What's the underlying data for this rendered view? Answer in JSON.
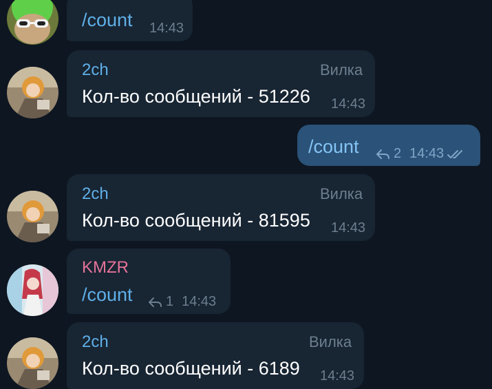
{
  "colors": {
    "background": "#0e1621",
    "bubble_in": "#182533",
    "bubble_out": "#2b5278",
    "sender_2ch": "#5fb0e8",
    "sender_kmzr": "#e57399",
    "command": "#5fb0e8",
    "muted": "#6d7f8f"
  },
  "messages": [
    {
      "text": "/count",
      "time": "14:43"
    },
    {
      "sender": "2ch",
      "badge": "Вилка",
      "text": "Кол-во сообщений - 51226",
      "time": "14:43"
    },
    {
      "text": "/count",
      "reply_count": "2",
      "time": "14:43",
      "status_icon": "double-check-icon"
    },
    {
      "sender": "2ch",
      "badge": "Вилка",
      "text": "Кол-во сообщений - 81595",
      "time": "14:43"
    },
    {
      "sender": "KMZR",
      "text": "/count",
      "reply_count": "1",
      "time": "14:43"
    },
    {
      "sender": "2ch",
      "badge": "Вилка",
      "text": "Кол-во сообщений - 6189",
      "time": "14:43"
    }
  ]
}
